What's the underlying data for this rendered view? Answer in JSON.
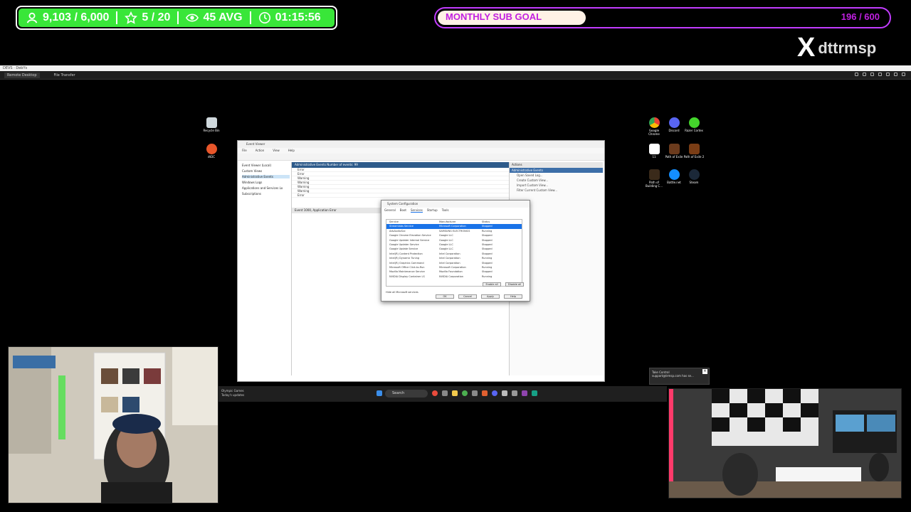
{
  "overlay": {
    "followers": "9,103 / 6,000",
    "stars": "5 / 20",
    "viewers": "45 AVG",
    "timer": "01:15:56",
    "sub_goal_label": "MONTHLY SUB GOAL",
    "sub_goal_count": "196 / 600",
    "sub_goal_progress": 0.33,
    "x_logo": "X",
    "x_handle": "dttrmsp",
    "accent_green": "#39e639",
    "accent_purple": "#c23cff"
  },
  "remote": {
    "title": "DEVS · DebYs",
    "tabs": [
      "Remote Desktop",
      "File Transfer"
    ]
  },
  "desktop": {
    "left_icons": [
      "Recycle Bin",
      "dtDC"
    ],
    "right_icons": [
      "Google Chrome",
      "Discord",
      "Razer Cortex",
      "11",
      "Path of Exile",
      "Path of Exile 2",
      "Path of Building C...",
      "Battle.net",
      "Steam"
    ]
  },
  "event_viewer": {
    "title": "Event Viewer",
    "menu": [
      "File",
      "Action",
      "View",
      "Help"
    ],
    "tree": [
      "Event Viewer (Local)",
      "Custom Views",
      "Administrative Events",
      "Windows Logs",
      "Applications and Services Lo",
      "Subscriptions"
    ],
    "header": "Administrative Events   Number of events: 99",
    "rows": [
      "Error",
      "Error",
      "Warning",
      "Warning",
      "Warning",
      "Warning",
      "Error"
    ],
    "detail_header": "Event 1000, Application Error",
    "actions_title": "Actions",
    "actions_sub": "Administrative Events",
    "actions": [
      "Open Saved Log...",
      "Create Custom View...",
      "Import Custom View...",
      "Filter Current Custom View..."
    ]
  },
  "sysconfig": {
    "title": "System Configuration",
    "tabs": [
      "General",
      "Boot",
      "Services",
      "Startup",
      "Tools"
    ],
    "rows": [
      {
        "service": "Service",
        "mfr": "Manufacturer",
        "status": "Status"
      },
      {
        "service": "Streamlabs Service",
        "mfr": "Microsoft Corporation",
        "status": "Stopped"
      },
      {
        "service": "AdvAudioSvc",
        "mfr": "SAMSUNG ELECTRONICS",
        "status": "Running"
      },
      {
        "service": "Google Chrome Elevation Service",
        "mfr": "Google LLC",
        "status": "Stopped"
      },
      {
        "service": "Google Updater Internal Service",
        "mfr": "Google LLC",
        "status": "Stopped"
      },
      {
        "service": "Google Updater Service",
        "mfr": "Google LLC",
        "status": "Stopped"
      },
      {
        "service": "Google Update Service",
        "mfr": "Google LLC",
        "status": "Stopped"
      },
      {
        "service": "Intel(R) Content Protection",
        "mfr": "Intel Corporation",
        "status": "Stopped"
      },
      {
        "service": "Intel(R) Dynamic Tuning",
        "mfr": "Intel Corporation",
        "status": "Running"
      },
      {
        "service": "Intel(R) Graphics Command",
        "mfr": "Intel Corporation",
        "status": "Stopped"
      },
      {
        "service": "Microsoft Office Click-to-Run",
        "mfr": "Microsoft Corporation",
        "status": "Running"
      },
      {
        "service": "Mozilla Maintenance Service",
        "mfr": "Mozilla Foundation",
        "status": "Stopped"
      },
      {
        "service": "NVIDIA Display Container LS",
        "mfr": "NVIDIA Corporation",
        "status": "Running"
      }
    ],
    "buttons": [
      "OK",
      "Cancel",
      "Apply",
      "Help"
    ],
    "hide_ms": "Hide all Microsoft services",
    "enable_all": "Enable all",
    "disable_all": "Disable all"
  },
  "taskbar": {
    "search": "Search",
    "notif_line1": "Olympic Games",
    "notif_line2": "Today's updates"
  },
  "toast": {
    "title": "Take Control",
    "body": "support@trmsp.com has se..."
  }
}
